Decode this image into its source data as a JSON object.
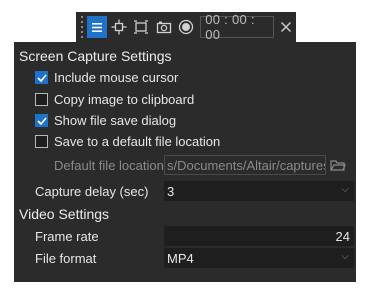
{
  "toolbar": {
    "timer": "00 : 00 : 00",
    "icons": [
      "menu-icon",
      "crosshair-icon",
      "region-icon",
      "camera-icon",
      "record-icon",
      "close-icon"
    ],
    "accent": "#1e73c8"
  },
  "screen_capture": {
    "title": "Screen Capture Settings",
    "options": [
      {
        "label": "Include mouse cursor",
        "checked": true
      },
      {
        "label": "Copy image to clipboard",
        "checked": false
      },
      {
        "label": "Show file save dialog",
        "checked": true
      },
      {
        "label": "Save to a default file location",
        "checked": false
      }
    ],
    "default_location_label": "Default file location",
    "default_location_value": "s/Documents/Altair/captures",
    "delay_label": "Capture delay (sec)",
    "delay_value": "3"
  },
  "video": {
    "title": "Video Settings",
    "frame_rate_label": "Frame rate",
    "frame_rate_value": "24",
    "file_format_label": "File format",
    "file_format_value": "MP4"
  }
}
